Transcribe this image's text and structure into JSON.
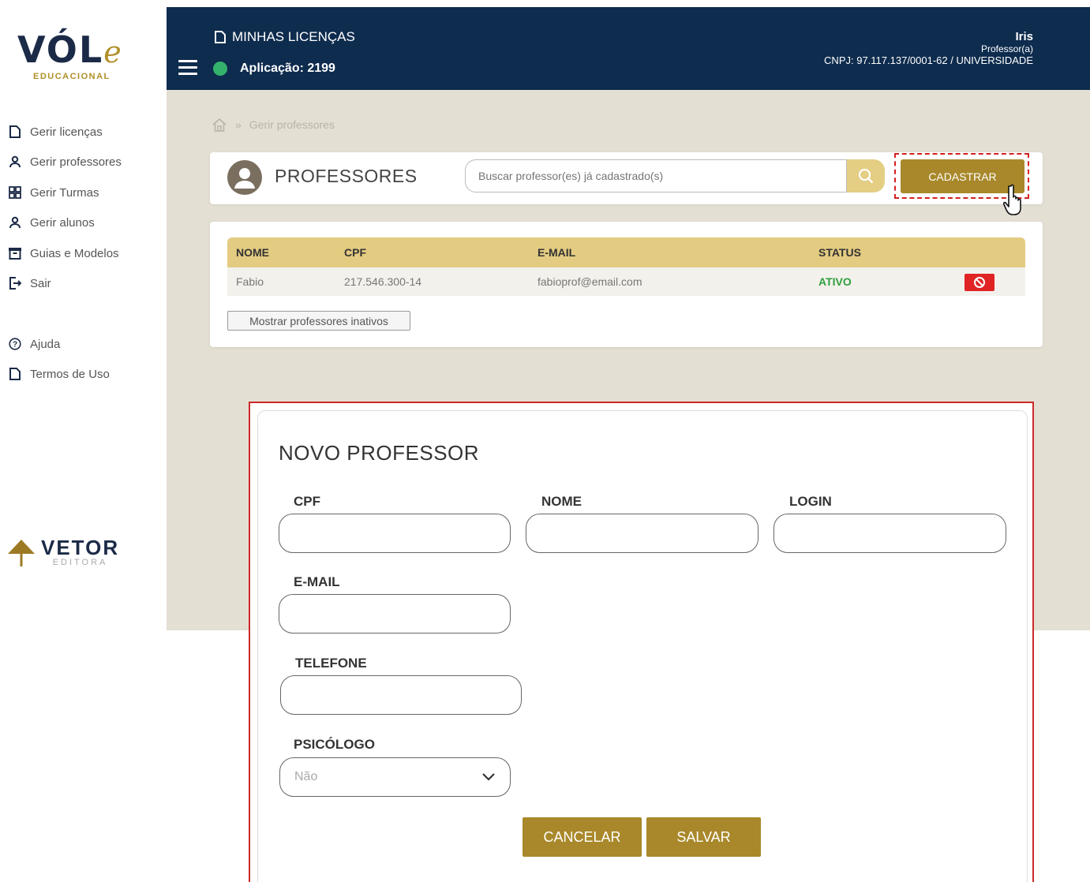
{
  "brand": {
    "logo_main": "VÓL",
    "logo_e": "e",
    "logo_sub": "EDUCACIONAL",
    "footer_main": "VETOR",
    "footer_sub": "EDITORA"
  },
  "sidebar": {
    "items": [
      {
        "label": "Gerir licenças",
        "icon": "file-icon"
      },
      {
        "label": "Gerir professores",
        "icon": "user-icon"
      },
      {
        "label": "Gerir Turmas",
        "icon": "grid-icon"
      },
      {
        "label": "Gerir alunos",
        "icon": "user-icon"
      },
      {
        "label": "Guias e Modelos",
        "icon": "archive-icon"
      },
      {
        "label": "Sair",
        "icon": "logout-icon"
      }
    ],
    "help": [
      {
        "label": "Ajuda",
        "icon": "help-icon"
      },
      {
        "label": "Termos de Uso",
        "icon": "file-icon"
      }
    ]
  },
  "header": {
    "title": "MINHAS LICENÇAS",
    "app": "Aplicação: 2199",
    "user_name": "Iris",
    "user_role": "Professor(a)",
    "user_org": "CNPJ: 97.117.137/0001-62 / UNIVERSIDADE"
  },
  "breadcrumb": {
    "separator": "»",
    "current": "Gerir professores"
  },
  "professors": {
    "title": "PROFESSORES",
    "search_placeholder": "Buscar professor(es) já cadastrado(s)",
    "register_label": "CADASTRAR",
    "columns": {
      "name": "NOME",
      "cpf": "CPF",
      "email": "E-MAIL",
      "status": "STATUS"
    },
    "rows": [
      {
        "name": "Fabio",
        "cpf": "217.546.300-14",
        "email": "fabioprof@email.com",
        "status": "ATIVO"
      }
    ],
    "show_inactive_label": "Mostrar professores inativos"
  },
  "modal": {
    "title": "NOVO PROFESSOR",
    "fields": {
      "cpf": "CPF",
      "nome": "NOME",
      "login": "LOGIN",
      "email": "E-MAIL",
      "telefone": "TELEFONE",
      "psicologo": "PSICÓLOGO"
    },
    "psicologo_value": "Não",
    "cancel_label": "CANCELAR",
    "save_label": "SALVAR"
  },
  "colors": {
    "navy": "#0e2c4e",
    "gold": "#a8882a",
    "gold_light": "#e3cb81",
    "status_active": "#2e9e3d",
    "danger": "#e02424"
  }
}
